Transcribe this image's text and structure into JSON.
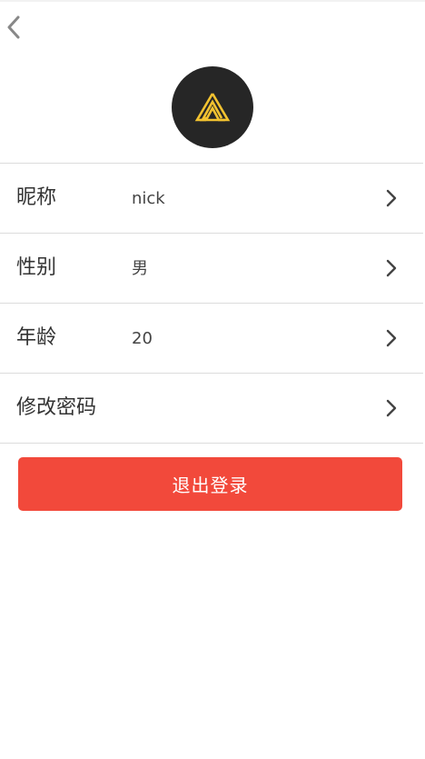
{
  "header": {
    "back_icon": "chevron-left-icon"
  },
  "avatar": {
    "icon": "app-logo-a",
    "background_color": "#262626",
    "logo_color": "#f2c230"
  },
  "profile_rows": [
    {
      "label": "昵称",
      "value": "nick"
    },
    {
      "label": "性别",
      "value": "男"
    },
    {
      "label": "年龄",
      "value": "20"
    },
    {
      "label": "修改密码",
      "value": ""
    }
  ],
  "actions": {
    "logout_label": "退出登录",
    "logout_color": "#f2493b"
  }
}
